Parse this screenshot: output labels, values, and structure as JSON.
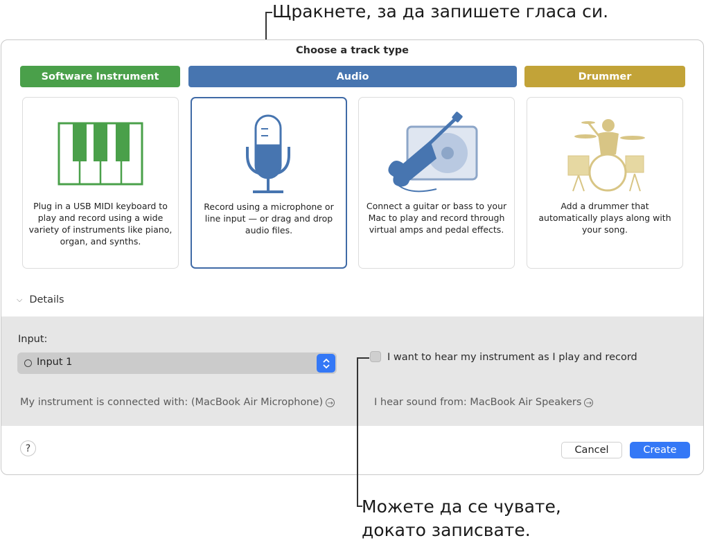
{
  "callouts": {
    "top": "Щракнете, за да запишете гласа си.",
    "bottom_line1": "Можете да се чувате,",
    "bottom_line2": "докато записвате."
  },
  "dialog": {
    "title": "Choose a track type",
    "tabs": [
      {
        "label": "Software Instrument",
        "color": "#4aa04a"
      },
      {
        "label": "Audio",
        "color": "#4775b0",
        "selected": true
      },
      {
        "label": "Drummer",
        "color": "#c2a338"
      }
    ],
    "cards": [
      {
        "icon": "piano-keyboard-icon",
        "description": "Plug in a USB MIDI keyboard to play and record using a wide variety of instruments like piano, organ, and synths."
      },
      {
        "icon": "microphone-icon",
        "description": "Record using a microphone or line input — or drag and drop audio files.",
        "selected": true
      },
      {
        "icon": "guitar-amp-icon",
        "description": "Connect a guitar or bass to your Mac to play and record through virtual amps and pedal effects."
      },
      {
        "icon": "drummer-icon",
        "description": "Add a drummer that automatically plays along with your song."
      }
    ],
    "details": {
      "toggle_label": "Details",
      "input_label": "Input:",
      "input_value": "Input 1",
      "monitor_checkbox_label": "I want to hear my instrument as I play and record",
      "monitor_checked": false,
      "connected_with": "My instrument is connected with: (MacBook Air Microphone)",
      "hear_from": "I hear sound from: MacBook Air Speakers"
    },
    "footer": {
      "help_label": "?",
      "cancel_label": "Cancel",
      "create_label": "Create"
    }
  }
}
